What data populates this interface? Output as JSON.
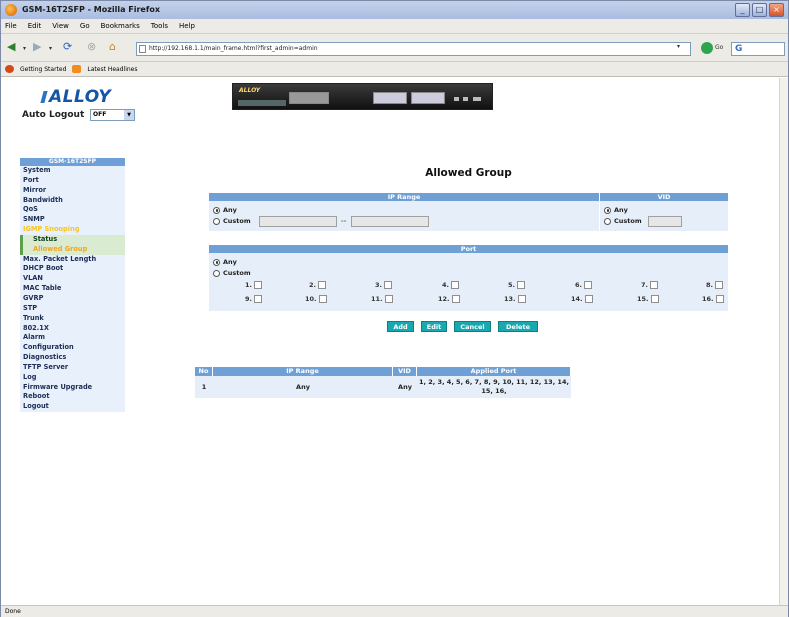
{
  "browser": {
    "window_title": "GSM-16T2SFP - Mozilla Firefox",
    "menu": [
      "File",
      "Edit",
      "View",
      "Go",
      "Bookmarks",
      "Tools",
      "Help"
    ],
    "url": "http://192.168.1.1/main_frame.html?first_admin=admin",
    "go_label": "Go",
    "search_letter": "G",
    "bookmarks": [
      "Getting Started",
      "Latest Headlines"
    ],
    "status": "Done"
  },
  "header": {
    "logo": "ALLOY",
    "device_tag": "ALLOY",
    "auto_logout_label": "Auto Logout",
    "auto_logout_value": "OFF"
  },
  "sidebar": {
    "title": "GSM-16T2SFP",
    "items_top": [
      "System",
      "Port",
      "Mirror",
      "Bandwidth",
      "QoS",
      "SNMP"
    ],
    "active_group": "IGMP Snooping",
    "sub_items": [
      "Status",
      "Allowed Group"
    ],
    "items_bottom": [
      "Max. Packet Length",
      "DHCP Boot",
      "VLAN",
      "MAC Table",
      "GVRP",
      "STP",
      "Trunk",
      "802.1X",
      "Alarm",
      "Configuration",
      "Diagnostics",
      "TFTP Server",
      "Log",
      "Firmware Upgrade",
      "Reboot",
      "Logout"
    ]
  },
  "page": {
    "title": "Allowed Group",
    "ip_range": {
      "header": "IP Range",
      "any_label": "Any",
      "custom_label": "Custom",
      "separator": "--",
      "selected": "Any"
    },
    "vid": {
      "header": "VID",
      "any_label": "Any",
      "custom_label": "Custom",
      "selected": "Any"
    },
    "port": {
      "header": "Port",
      "any_label": "Any",
      "custom_label": "Custom",
      "selected": "Any",
      "labels": [
        "1.",
        "2.",
        "3.",
        "4.",
        "5.",
        "6.",
        "7.",
        "8.",
        "9.",
        "10.",
        "11.",
        "12.",
        "13.",
        "14.",
        "15.",
        "16."
      ]
    },
    "buttons": {
      "add": "Add",
      "edit": "Edit",
      "cancel": "Cancel",
      "delete": "Delete"
    },
    "table": {
      "headers": [
        "No",
        "IP Range",
        "VID",
        "Applied Port"
      ],
      "rows": [
        {
          "no": "1",
          "ip_range": "Any",
          "vid": "Any",
          "applied_port": "1, 2, 3, 4, 5, 6, 7, 8, 9, 10, 11, 12, 13, 14, 15, 16,"
        }
      ]
    }
  },
  "colors": {
    "header_blue": "#6ea0d6",
    "panel_blue": "#e6eff9",
    "button_teal": "#1aa8b0",
    "highlight_yellow": "#f6c425"
  }
}
